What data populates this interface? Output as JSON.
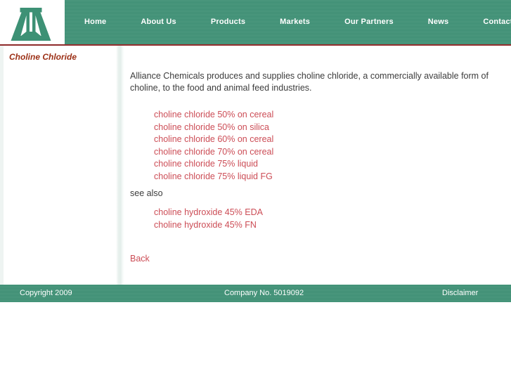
{
  "site": {
    "logo_alt": "Alliance Chemicals logo",
    "accent_green": "#3d9175",
    "accent_red": "#cc4d56",
    "title_red": "#9c3016",
    "rule_red": "#8f2a2a"
  },
  "nav": {
    "items": [
      {
        "label": "Home"
      },
      {
        "label": "About Us"
      },
      {
        "label": "Products"
      },
      {
        "label": "Markets"
      },
      {
        "label": "Our Partners"
      },
      {
        "label": "News"
      },
      {
        "label": "Contact Us"
      }
    ]
  },
  "sidebar": {
    "title": "Choline Chloride"
  },
  "main": {
    "intro": "Alliance Chemicals produces and supplies choline chloride, a commercially available form of choline, to the food and animal feed industries.",
    "products": [
      {
        "label": "choline chloride 50% on cereal"
      },
      {
        "label": "choline chloride 50% on silica"
      },
      {
        "label": "choline chloride 60% on cereal"
      },
      {
        "label": "choline chloride 70% on cereal"
      },
      {
        "label": "choline chloride 75% liquid"
      },
      {
        "label": "choline chloride 75% liquid FG"
      }
    ],
    "see_also_label": "see also",
    "related": [
      {
        "label": "choline hydroxide 45% EDA"
      },
      {
        "label": "choline hydroxide 45% FN"
      }
    ],
    "back_label": "Back"
  },
  "footer": {
    "copyright": "Copyright 2009",
    "company_no": "Company No. 5019092",
    "disclaimer": "Disclaimer"
  }
}
